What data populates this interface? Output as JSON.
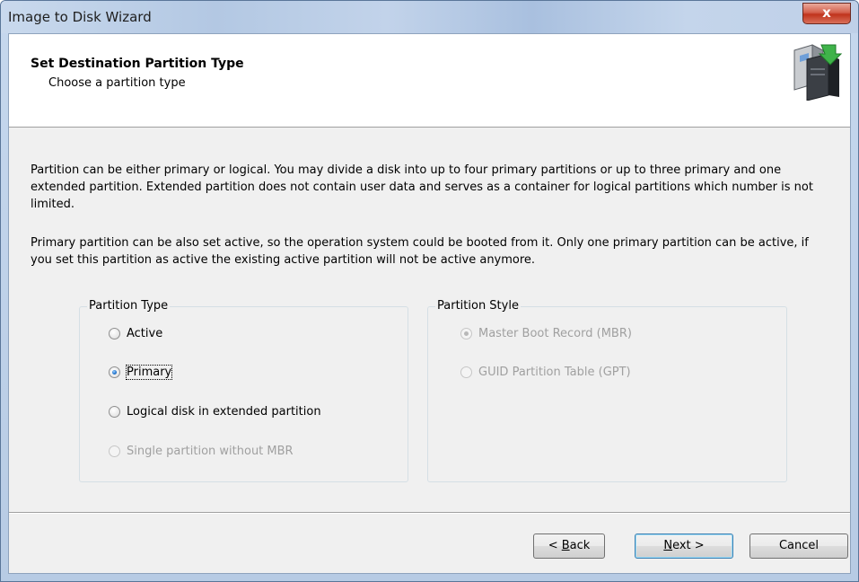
{
  "window": {
    "title": "Image to Disk Wizard",
    "close_glyph": "x"
  },
  "header": {
    "title": "Set Destination Partition Type",
    "subtitle": "Choose a partition type",
    "icon": "disk-wizard-icon"
  },
  "description": {
    "paragraph1": "Partition can be either primary or logical. You may divide a disk into up to four primary partitions or up to three primary and one extended partition. Extended partition does not contain user data and serves as a container for logical partitions which number is not limited.",
    "paragraph2": "Primary partition can be also set active, so the operation system could be booted from it. Only one primary partition can be active, if you set this partition as active the existing active partition will not be active anymore."
  },
  "partition_type": {
    "legend": "Partition Type",
    "options": [
      {
        "label": "Active",
        "checked": false,
        "enabled": true
      },
      {
        "label": "Primary",
        "checked": true,
        "enabled": true
      },
      {
        "label": "Logical disk in extended partition",
        "checked": false,
        "enabled": true
      },
      {
        "label": "Single partition without MBR",
        "checked": false,
        "enabled": false
      }
    ]
  },
  "partition_style": {
    "legend": "Partition Style",
    "options": [
      {
        "label": "Master Boot Record (MBR)",
        "checked": true,
        "enabled": false
      },
      {
        "label": "GUID Partition Table (GPT)",
        "checked": false,
        "enabled": false
      }
    ]
  },
  "buttons": {
    "back": {
      "prefix": "< ",
      "mnemonic": "B",
      "rest": "ack"
    },
    "next": {
      "mnemonic": "N",
      "rest": "ext >"
    },
    "cancel": "Cancel"
  },
  "colors": {
    "title_bar": "#b9cde6",
    "close_button": "#c8452f",
    "dialog_background": "#f0f0f0",
    "radio_selected": "#1b6fc9"
  }
}
